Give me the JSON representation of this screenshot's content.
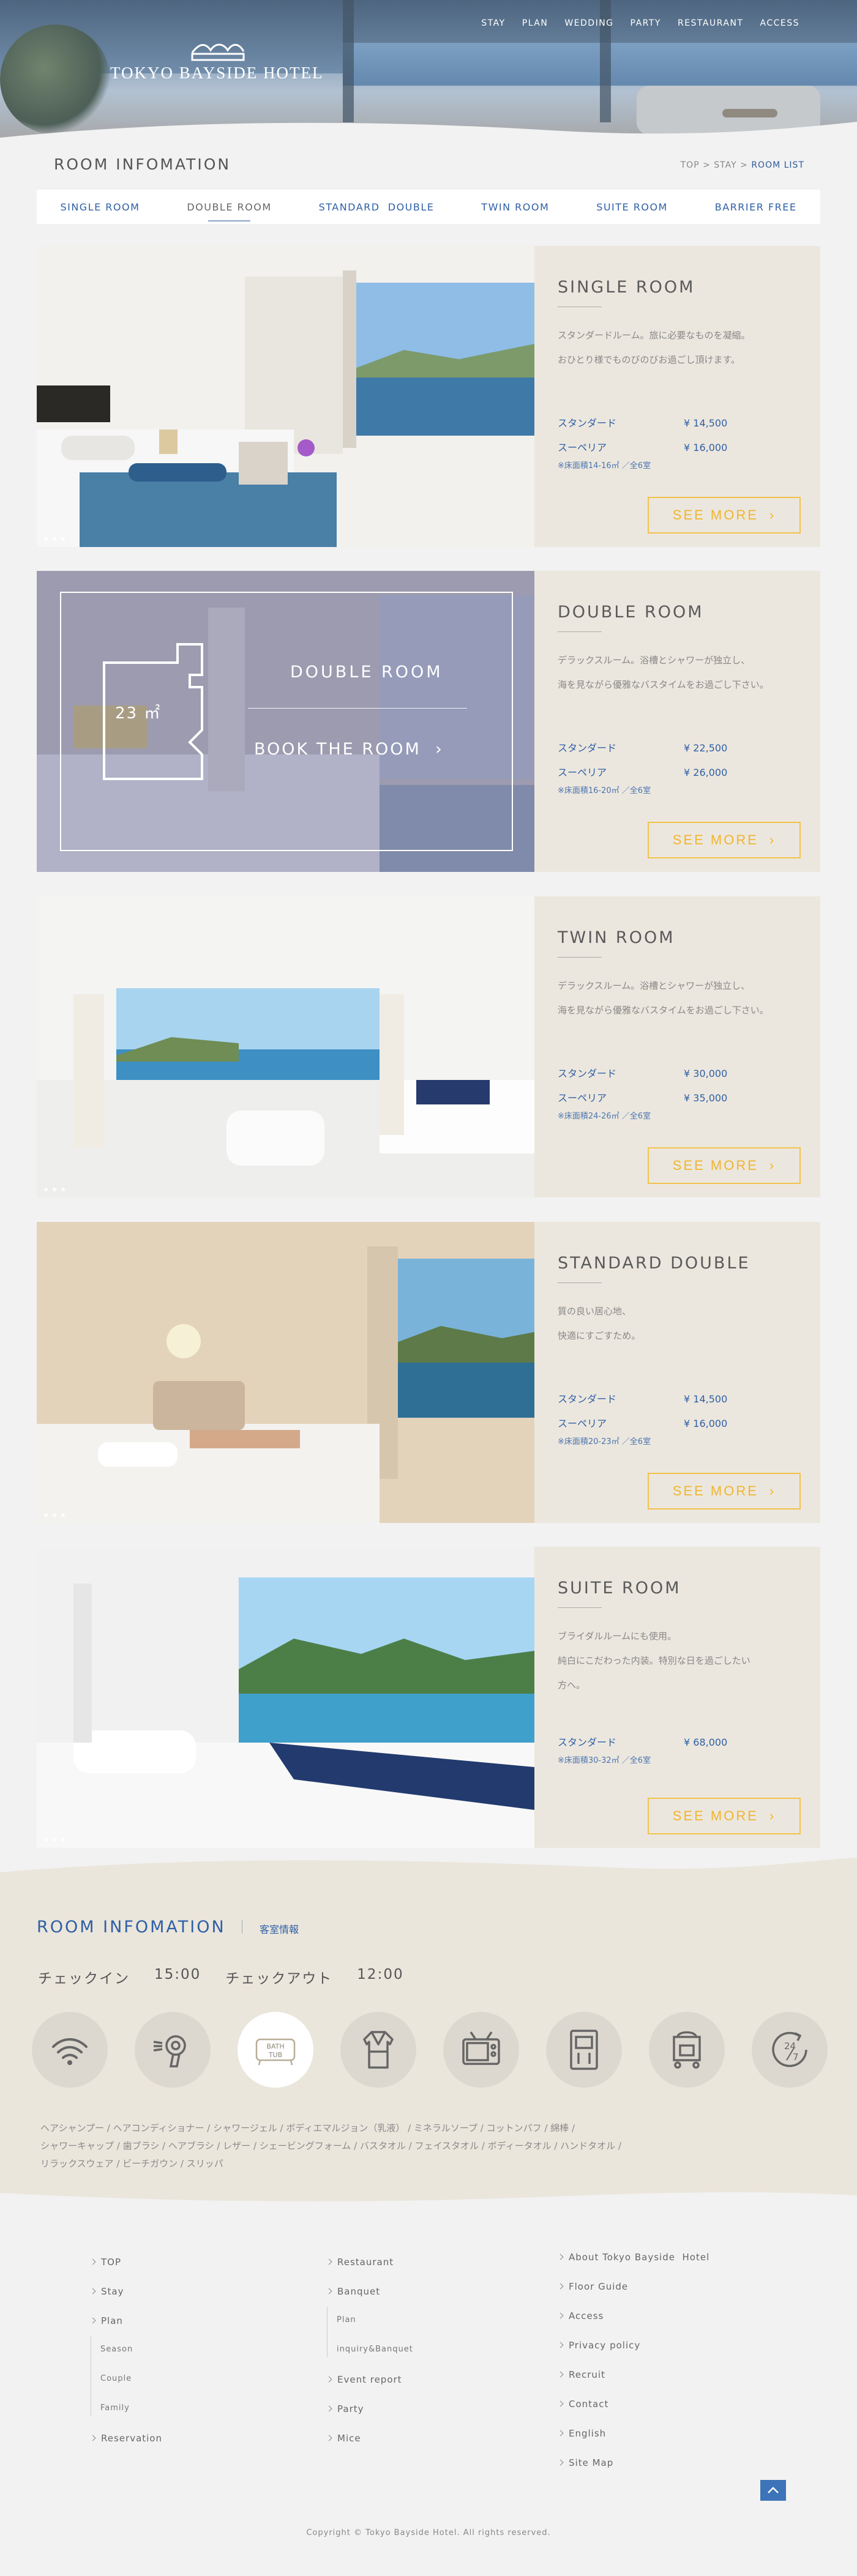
{
  "header": {
    "logo_text": "TOKYO BAYSIDE HOTEL",
    "nav": [
      "STAY",
      "PLAN",
      "WEDDING",
      "PARTY",
      "RESTAURANT",
      "ACCESS"
    ]
  },
  "title_bar": {
    "title": "ROOM INFOMATION",
    "breadcrumb": {
      "top": "TOP",
      "sep1": ">",
      "stay": "STAY",
      "sep2": ">",
      "current": "ROOM LIST"
    }
  },
  "tabs": [
    {
      "label": "SINGLE ROOM",
      "active": false
    },
    {
      "label": "DOUBLE ROOM",
      "active": true
    },
    {
      "label": "STANDARD  DOUBLE",
      "active": false
    },
    {
      "label": "TWIN ROOM",
      "active": false
    },
    {
      "label": "SUITE ROOM",
      "active": false
    },
    {
      "label": "BARRIER FREE",
      "active": false
    }
  ],
  "rooms": [
    {
      "name": "SINGLE ROOM",
      "desc": [
        "スタンダードルーム。旅に必要なものを凝縮。",
        "おひとり様でものびのびお過ごし頂けます。"
      ],
      "prices": [
        {
          "label": "スタンダード",
          "value": "¥ 14,500"
        },
        {
          "label": "スーペリア",
          "value": "¥ 16,000"
        }
      ],
      "area": "※床面積14-16㎡ ／全6室",
      "more": "SEE MORE"
    },
    {
      "name": "DOUBLE ROOM",
      "desc": [
        "デラックスルーム。浴槽とシャワーが独立し、",
        "海を見ながら優雅なバスタイムをお過ごし下さい。"
      ],
      "prices": [
        {
          "label": "スタンダード",
          "value": "¥ 22,500"
        },
        {
          "label": "スーペリア",
          "value": "¥ 26,000"
        }
      ],
      "area": "※床面積16-20㎡ ／全6室",
      "more": "SEE MORE",
      "overlay": {
        "size": "23 ㎡",
        "name": "DOUBLE ROOM",
        "book": "BOOK THE ROOM  ›"
      }
    },
    {
      "name": "TWIN ROOM",
      "desc": [
        "デラックスルーム。浴槽とシャワーが独立し、",
        "海を見ながら優雅なバスタイムをお過ごし下さい。"
      ],
      "prices": [
        {
          "label": "スタンダード",
          "value": "¥ 30,000"
        },
        {
          "label": "スーペリア",
          "value": "¥ 35,000"
        }
      ],
      "area": "※床面積24-26㎡ ／全6室",
      "more": "SEE MORE"
    },
    {
      "name": "STANDARD DOUBLE",
      "desc": [
        "質の良い居心地、",
        "快適にすごすため。"
      ],
      "prices": [
        {
          "label": "スタンダード",
          "value": "¥ 14,500"
        },
        {
          "label": "スーペリア",
          "value": "¥ 16,000"
        }
      ],
      "area": "※床面積20-23㎡ ／全6室",
      "more": "SEE MORE"
    },
    {
      "name": "SUITE ROOM",
      "desc": [
        "ブライダルルームにも使用。",
        "純白にこだわった内装。特別な日を過ごしたい",
        "方へ。"
      ],
      "prices": [
        {
          "label": "スタンダード",
          "value": "¥ 68,000"
        }
      ],
      "area": "※床面積30-32㎡ ／全6室",
      "more": "SEE MORE"
    }
  ],
  "amenity": {
    "title": "ROOM INFOMATION",
    "subtitle": "客室情報",
    "checkin_label": "チェックイン",
    "checkin_time": "15:00",
    "checkout_label": "チェックアウト",
    "checkout_time": "12:00",
    "icons": [
      "wifi-icon",
      "hair-dryer-icon",
      "bath-tub-icon",
      "bathrobe-icon",
      "tv-icon",
      "fridge-icon",
      "luggage-cart-icon",
      "24-7-icon"
    ],
    "bath_tub_label_1": "BATH",
    "bath_tub_label_2": "TUB",
    "hours_label_1": "24",
    "hours_label_2": "7",
    "list_line1": "ヘアシャンプー / ヘアコンディショナー / シャワージェル / ボディエマルジョン（乳液） / ミネラルソープ / コットンパフ / 綿棒 /",
    "list_line2": "シャワーキャップ / 歯ブラシ / ヘアブラシ / レザー / シェービングフォーム / バスタオル / フェイスタオル / ボディータオル / ハンドタオル /",
    "list_line3": "リラックスウェア / ビーチガウン / スリッパ"
  },
  "footer": {
    "col1": {
      "top": "TOP",
      "stay": "Stay",
      "plan": "Plan",
      "season": "Season",
      "couple": "Couple",
      "family": "Family",
      "reservation": "Reservation"
    },
    "col2": {
      "restaurant": "Restaurant",
      "banquet": "Banquet",
      "plan": "Plan",
      "inquiry": "inquiry&Banquet",
      "event": "Event report",
      "party": "Party",
      "mice": "Mice"
    },
    "col3": {
      "about": "About Tokyo Bayside  Hotel",
      "floor": "Floor Guide",
      "access": "Access",
      "privacy": "Privacy policy",
      "recruit": "Recruit",
      "contact": "Contact",
      "english": "English",
      "sitemap": "Site Map"
    },
    "copyright": "Copyright © Tokyo Bayside Hotel. All rights reserved."
  },
  "colors": {
    "accent_blue": "#2e5fa5",
    "button_gold": "#efb52f",
    "card_beige": "#ece7de"
  }
}
